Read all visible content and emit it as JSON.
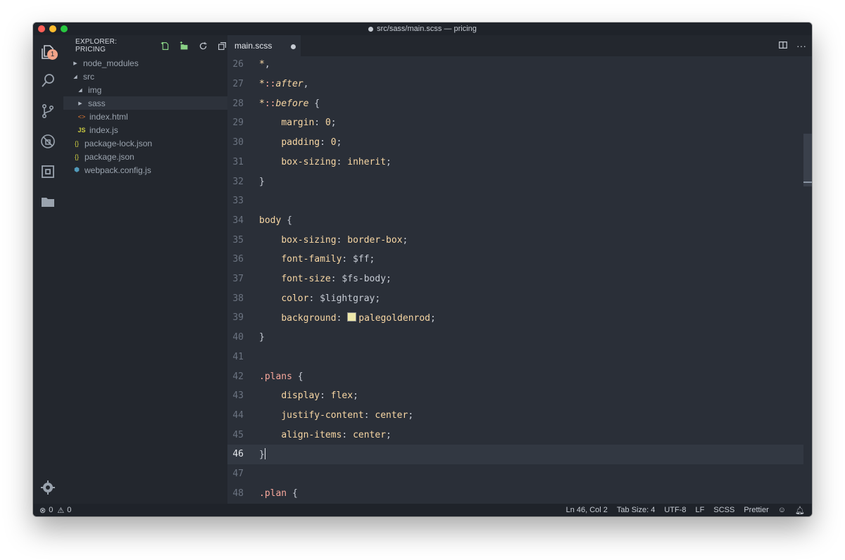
{
  "window": {
    "title": "src/sass/main.scss — pricing"
  },
  "activity": {
    "explorer_badge": "1"
  },
  "sidebar": {
    "header": "EXPLORER: PRICING",
    "items": [
      {
        "label": "node_modules",
        "type": "folder",
        "expanded": false,
        "depth": 1
      },
      {
        "label": "src",
        "type": "folder",
        "expanded": true,
        "depth": 1
      },
      {
        "label": "img",
        "type": "folder",
        "expanded": true,
        "depth": 2
      },
      {
        "label": "sass",
        "type": "folder",
        "expanded": false,
        "depth": 2,
        "selected": true
      },
      {
        "label": "index.html",
        "type": "html",
        "depth": 2
      },
      {
        "label": "index.js",
        "type": "js",
        "depth": 2
      },
      {
        "label": "package-lock.json",
        "type": "json",
        "depth": 1
      },
      {
        "label": "package.json",
        "type": "json",
        "depth": 1
      },
      {
        "label": "webpack.config.js",
        "type": "webpack",
        "depth": 1
      }
    ]
  },
  "editor": {
    "tab": "main.scss",
    "current_line": 46,
    "lines": [
      {
        "n": "26",
        "text": "*,"
      },
      {
        "n": "27",
        "text": "*::after,"
      },
      {
        "n": "28",
        "text": "*::before {"
      },
      {
        "n": "29",
        "text": "    margin: 0;"
      },
      {
        "n": "30",
        "text": "    padding: 0;"
      },
      {
        "n": "31",
        "text": "    box-sizing: inherit;"
      },
      {
        "n": "32",
        "text": "}"
      },
      {
        "n": "33",
        "text": ""
      },
      {
        "n": "34",
        "text": "body {"
      },
      {
        "n": "35",
        "text": "    box-sizing: border-box;"
      },
      {
        "n": "36",
        "text": "    font-family: $ff;"
      },
      {
        "n": "37",
        "text": "    font-size: $fs-body;"
      },
      {
        "n": "38",
        "text": "    color: $lightgray;"
      },
      {
        "n": "39",
        "text": "    background: palegoldenrod;"
      },
      {
        "n": "40",
        "text": "}"
      },
      {
        "n": "41",
        "text": ""
      },
      {
        "n": "42",
        "text": ".plans {"
      },
      {
        "n": "43",
        "text": "    display: flex;"
      },
      {
        "n": "44",
        "text": "    justify-content: center;"
      },
      {
        "n": "45",
        "text": "    align-items: center;"
      },
      {
        "n": "46",
        "text": "}"
      },
      {
        "n": "47",
        "text": ""
      },
      {
        "n": "48",
        "text": ".plan {"
      }
    ]
  },
  "status": {
    "errors": "0",
    "warnings": "0",
    "position": "Ln 46, Col 2",
    "tab_size": "Tab Size: 4",
    "encoding": "UTF-8",
    "eol": "LF",
    "language": "SCSS",
    "formatter": "Prettier"
  },
  "colors": {
    "editor_bg": "#2a2f38",
    "sidebar_bg": "#23272e",
    "property": "#f8d7a4",
    "class_selector": "#f7a79c",
    "swatch": "#eee8aa"
  }
}
